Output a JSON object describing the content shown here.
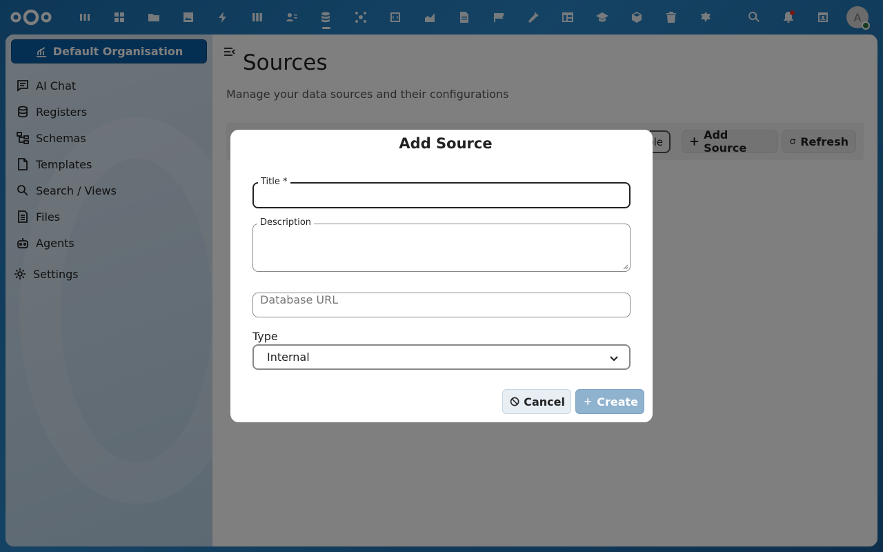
{
  "topbar": {
    "apps": [
      "dashboard",
      "apps-grid",
      "files",
      "photos",
      "activity",
      "deck",
      "contacts",
      "openregister",
      "circles",
      "code",
      "analytics",
      "documents",
      "flag",
      "tools",
      "tables",
      "learning",
      "cube",
      "trash",
      "settings-app"
    ],
    "active_app": "openregister",
    "avatar_letter": "A"
  },
  "sidebar": {
    "org_button": "Default Organisation",
    "items": [
      {
        "label": "AI Chat",
        "icon": "chat-icon"
      },
      {
        "label": "Registers",
        "icon": "database-icon"
      },
      {
        "label": "Schemas",
        "icon": "schema-icon"
      },
      {
        "label": "Templates",
        "icon": "document-icon"
      },
      {
        "label": "Search / Views",
        "icon": "search-icon"
      },
      {
        "label": "Files",
        "icon": "files-icon"
      },
      {
        "label": "Agents",
        "icon": "robot-icon"
      }
    ],
    "settings": "Settings"
  },
  "main": {
    "title": "Sources",
    "subtitle": "Manage your data sources and their configurations",
    "toolbar": {
      "partial_label": "ble",
      "add_label": "Add Source",
      "refresh_label": "Refresh"
    }
  },
  "modal": {
    "title": "Add Source",
    "title_field": {
      "legend": "Title *",
      "value": ""
    },
    "description_field": {
      "legend": "Description",
      "value": ""
    },
    "url_field": {
      "placeholder": "Database URL",
      "value": ""
    },
    "type_label": "Type",
    "type_value": "Internal",
    "cancel_label": "Cancel",
    "create_label": "Create"
  },
  "colors": {
    "accent": "#0b5fa5",
    "create_disabled": "#8fb2cf"
  }
}
